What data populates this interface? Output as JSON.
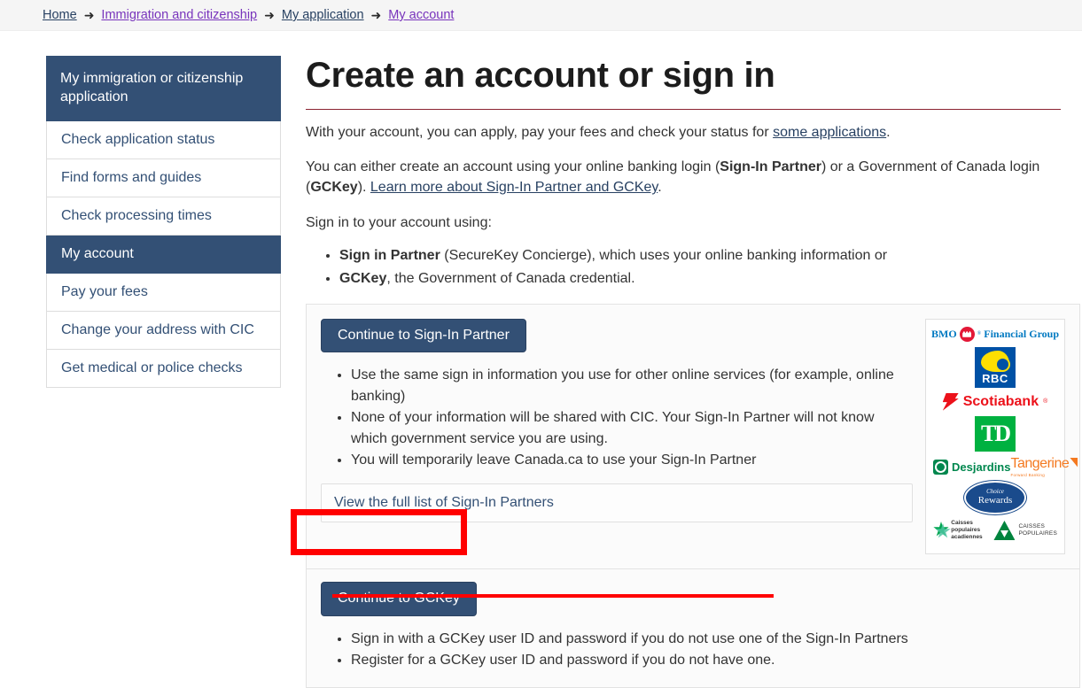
{
  "breadcrumb": {
    "separator": "➜",
    "items": [
      {
        "label": "Home",
        "state": "unvisited"
      },
      {
        "label": "Immigration and citizenship",
        "state": "visited"
      },
      {
        "label": "My application",
        "state": "unvisited"
      },
      {
        "label": "My account",
        "state": "visited"
      }
    ]
  },
  "sidebar": {
    "heading": "My immigration or citizenship application",
    "items": [
      {
        "label": "Check application status",
        "active": false
      },
      {
        "label": "Find forms and guides",
        "active": false
      },
      {
        "label": "Check processing times",
        "active": false
      },
      {
        "label": "My account",
        "active": true
      },
      {
        "label": "Pay your fees",
        "active": false
      },
      {
        "label": "Change your address with CIC",
        "active": false
      },
      {
        "label": "Get medical or police checks",
        "active": false
      }
    ]
  },
  "main": {
    "title": "Create an account or sign in",
    "intro_1_pre": "With your account, you can apply, pay your fees and check your status for ",
    "intro_1_link": "some applications",
    "intro_1_post": ".",
    "intro_2_pre": "You can either create an account using your online banking login (",
    "intro_2_b1": "Sign-In Partner",
    "intro_2_mid": ") or a Government of Canada login (",
    "intro_2_b2": "GCKey",
    "intro_2_post": "). ",
    "intro_2_link": "Learn more about Sign-In Partner and GCKey",
    "intro_2_end": ".",
    "signin_lead": "Sign in to your account using:",
    "signin_bullets": [
      {
        "bold": "Sign in Partner",
        "rest": " (SecureKey Concierge), which uses your online banking information or"
      },
      {
        "bold": "GCKey",
        "rest": ", the Government of Canada credential."
      }
    ]
  },
  "partner_panel": {
    "button_label": "Continue to Sign-In Partner",
    "bullets": [
      "Use the same sign in information you use for other online services (for example, online banking)",
      "None of your information will be shared with CIC. Your Sign-In Partner will not know which government service you are using.",
      "You will temporarily leave Canada.ca to use your Sign-In Partner"
    ],
    "accordion_label": "View the full list of Sign-In Partners",
    "logos": [
      {
        "name": "bmo-logo",
        "text": "BMO",
        "text2": "Financial Group"
      },
      {
        "name": "rbc-logo",
        "text": "RBC"
      },
      {
        "name": "scotiabank-logo",
        "text": "Scotiabank"
      },
      {
        "name": "td-logo",
        "text": "TD"
      },
      {
        "name": "desjardins-logo",
        "text": "Desjardins"
      },
      {
        "name": "tangerine-logo",
        "text": "Tangerine",
        "text2": "Forward Banking"
      },
      {
        "name": "choice-rewards-logo",
        "text": "Choice",
        "text2": "Rewards"
      },
      {
        "name": "caisses-populaires-acadiennes-logo",
        "text": "Caisses populaires",
        "text2": "acadiennes"
      },
      {
        "name": "caisses-populaires-logo",
        "text": "CAISSES",
        "text2": "POPULAIRES"
      }
    ]
  },
  "gckey_panel": {
    "button_label": "Continue to GCKey",
    "bullets": [
      "Sign in with a GCKey user ID and password if you do not use one of the Sign-In Partners",
      "Register for a GCKey user ID and password if you do not have one."
    ]
  },
  "annotations": {
    "highlight_color": "#ff0000",
    "box_target": "continue-to-gckey-button",
    "underline_target": "gckey-bullet-register"
  }
}
